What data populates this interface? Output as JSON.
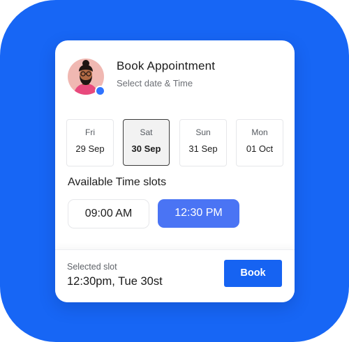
{
  "header": {
    "title": "Book Appointment",
    "subtitle": "Select date & Time",
    "avatar_icon": "person-avatar-icon",
    "status_color": "#2f73ff"
  },
  "dates": [
    {
      "day": "Fri",
      "date": "29 Sep",
      "selected": false
    },
    {
      "day": "Sat",
      "date": "30 Sep",
      "selected": true
    },
    {
      "day": "Sun",
      "date": "31 Sep",
      "selected": false
    },
    {
      "day": "Mon",
      "date": "01 Oct",
      "selected": false
    }
  ],
  "slots": {
    "heading": "Available Time slots",
    "items": [
      {
        "label": "09:00 AM",
        "selected": false
      },
      {
        "label": "12:30 PM",
        "selected": true
      }
    ]
  },
  "footer": {
    "label": "Selected slot",
    "value": "12:30pm, Tue 30st",
    "book_label": "Book"
  },
  "colors": {
    "background": "#1766f5",
    "accent": "#4a74f4",
    "button": "#1663f2"
  }
}
